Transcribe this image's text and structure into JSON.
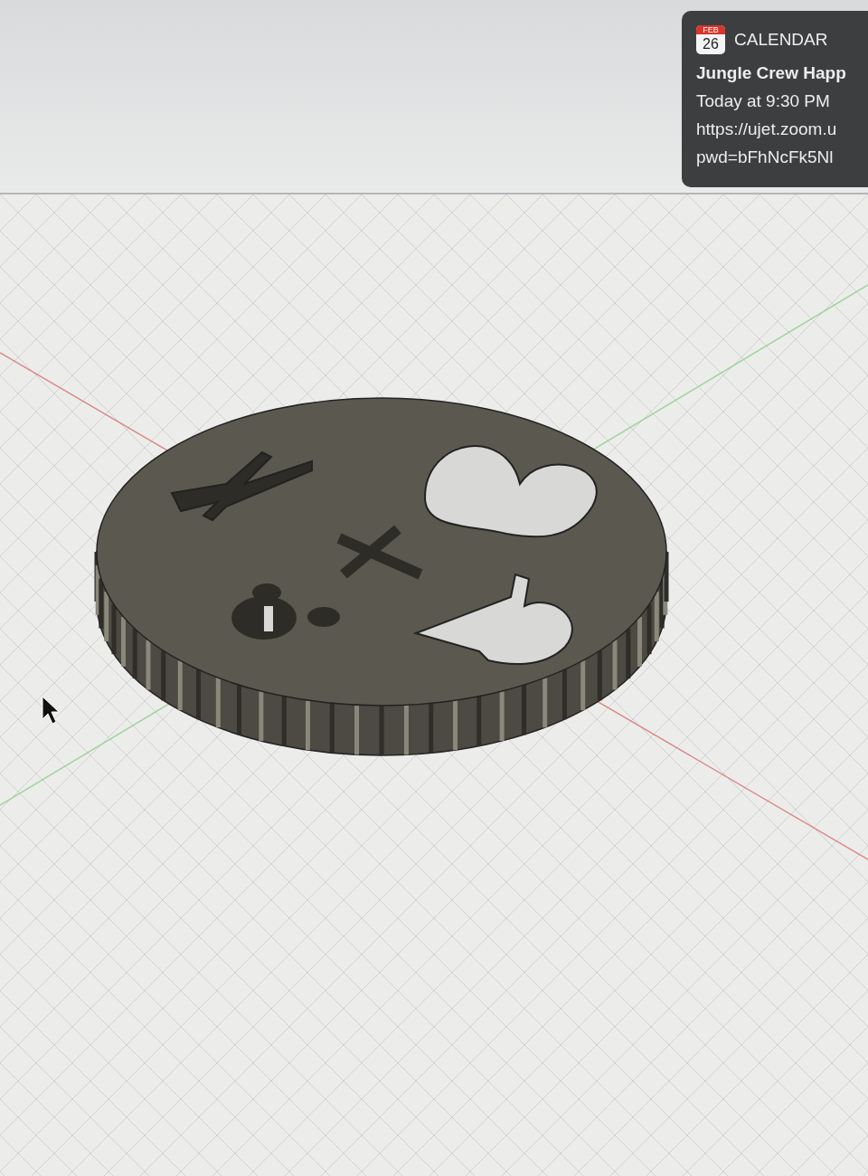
{
  "notification": {
    "app_icon": {
      "month": "FEB",
      "day": "26"
    },
    "app": "CALENDAR",
    "title": "Jungle Crew Happ",
    "time": "Today at 9:30 PM",
    "lines": [
      "https://ujet.zoom.u",
      "pwd=bFhNcFk5Nl"
    ]
  }
}
